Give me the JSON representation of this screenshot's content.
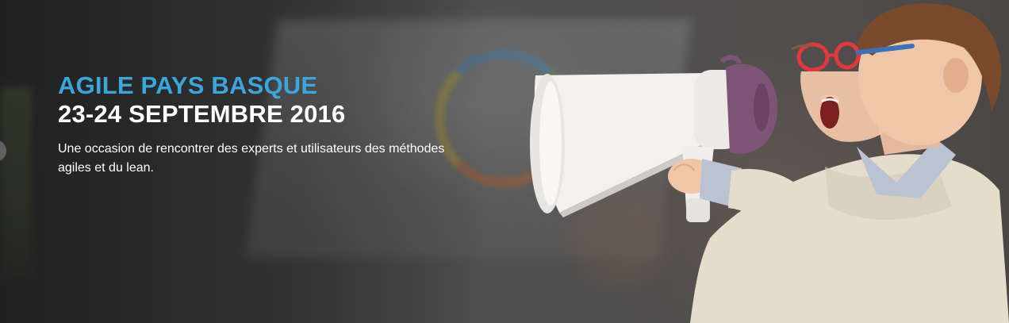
{
  "hero": {
    "title": "AGILE PAYS BASQUE",
    "date": "23-24 SEPTEMBRE 2016",
    "description": "Une occasion de rencontrer des experts et utilisateurs des méthodes agiles et du lean."
  },
  "colors": {
    "title_accent": "#3aa6dc",
    "text": "#ffffff"
  },
  "icons": {
    "slider_prev": "chevron-left-icon",
    "illustration": "kid-megaphone-image"
  }
}
